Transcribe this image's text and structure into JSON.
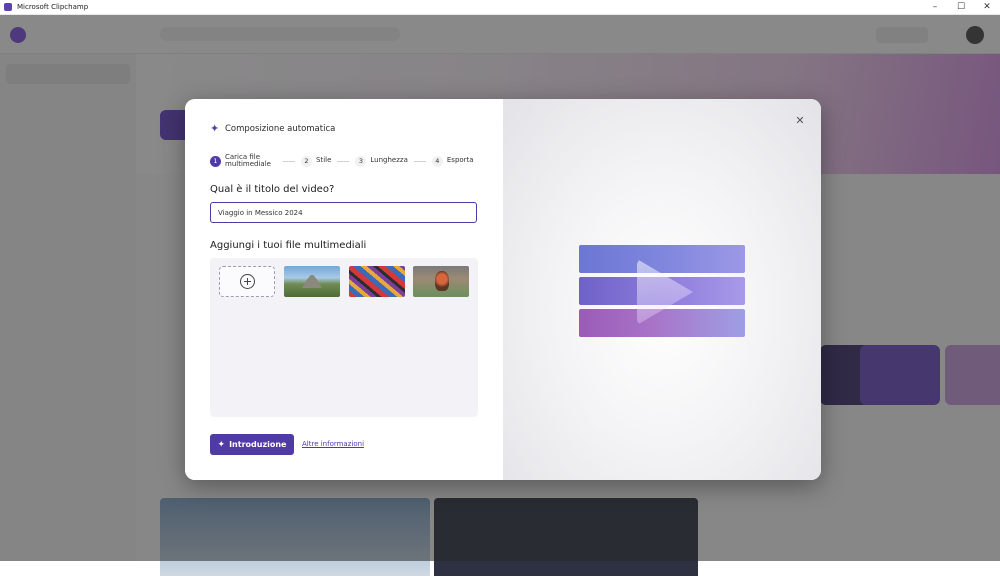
{
  "window": {
    "title": "Microsoft Clipchamp",
    "minimize": "–",
    "maximize": "☐",
    "close": "✕"
  },
  "dialog": {
    "header_icon": "sparkle-icon",
    "title": "Composizione automatica",
    "steps": [
      {
        "number": "1",
        "label": "Carica file multimediale",
        "active": true
      },
      {
        "number": "2",
        "label": "Stile",
        "active": false
      },
      {
        "number": "3",
        "label": "Lunghezza",
        "active": false
      },
      {
        "number": "4",
        "label": "Esporta",
        "active": false
      }
    ],
    "video_title_question": "Qual è il titolo del video?",
    "video_title_value": "Viaggio in Messico 2024",
    "media_heading": "Aggiungi i tuoi file multimediali",
    "add_media_icon": "plus-circle-icon",
    "media_items": [
      {
        "icon": "pyramid-photo"
      },
      {
        "icon": "colorful-mural-photo"
      },
      {
        "icon": "person-portrait-photo"
      }
    ],
    "primary_button_label": "Introduzione",
    "primary_button_icon": "sparkle-icon",
    "more_info_link": "Altre informazioni",
    "close_icon": "close-icon"
  },
  "colors": {
    "accent": "#4f3aa6",
    "overlay": "#282828"
  }
}
